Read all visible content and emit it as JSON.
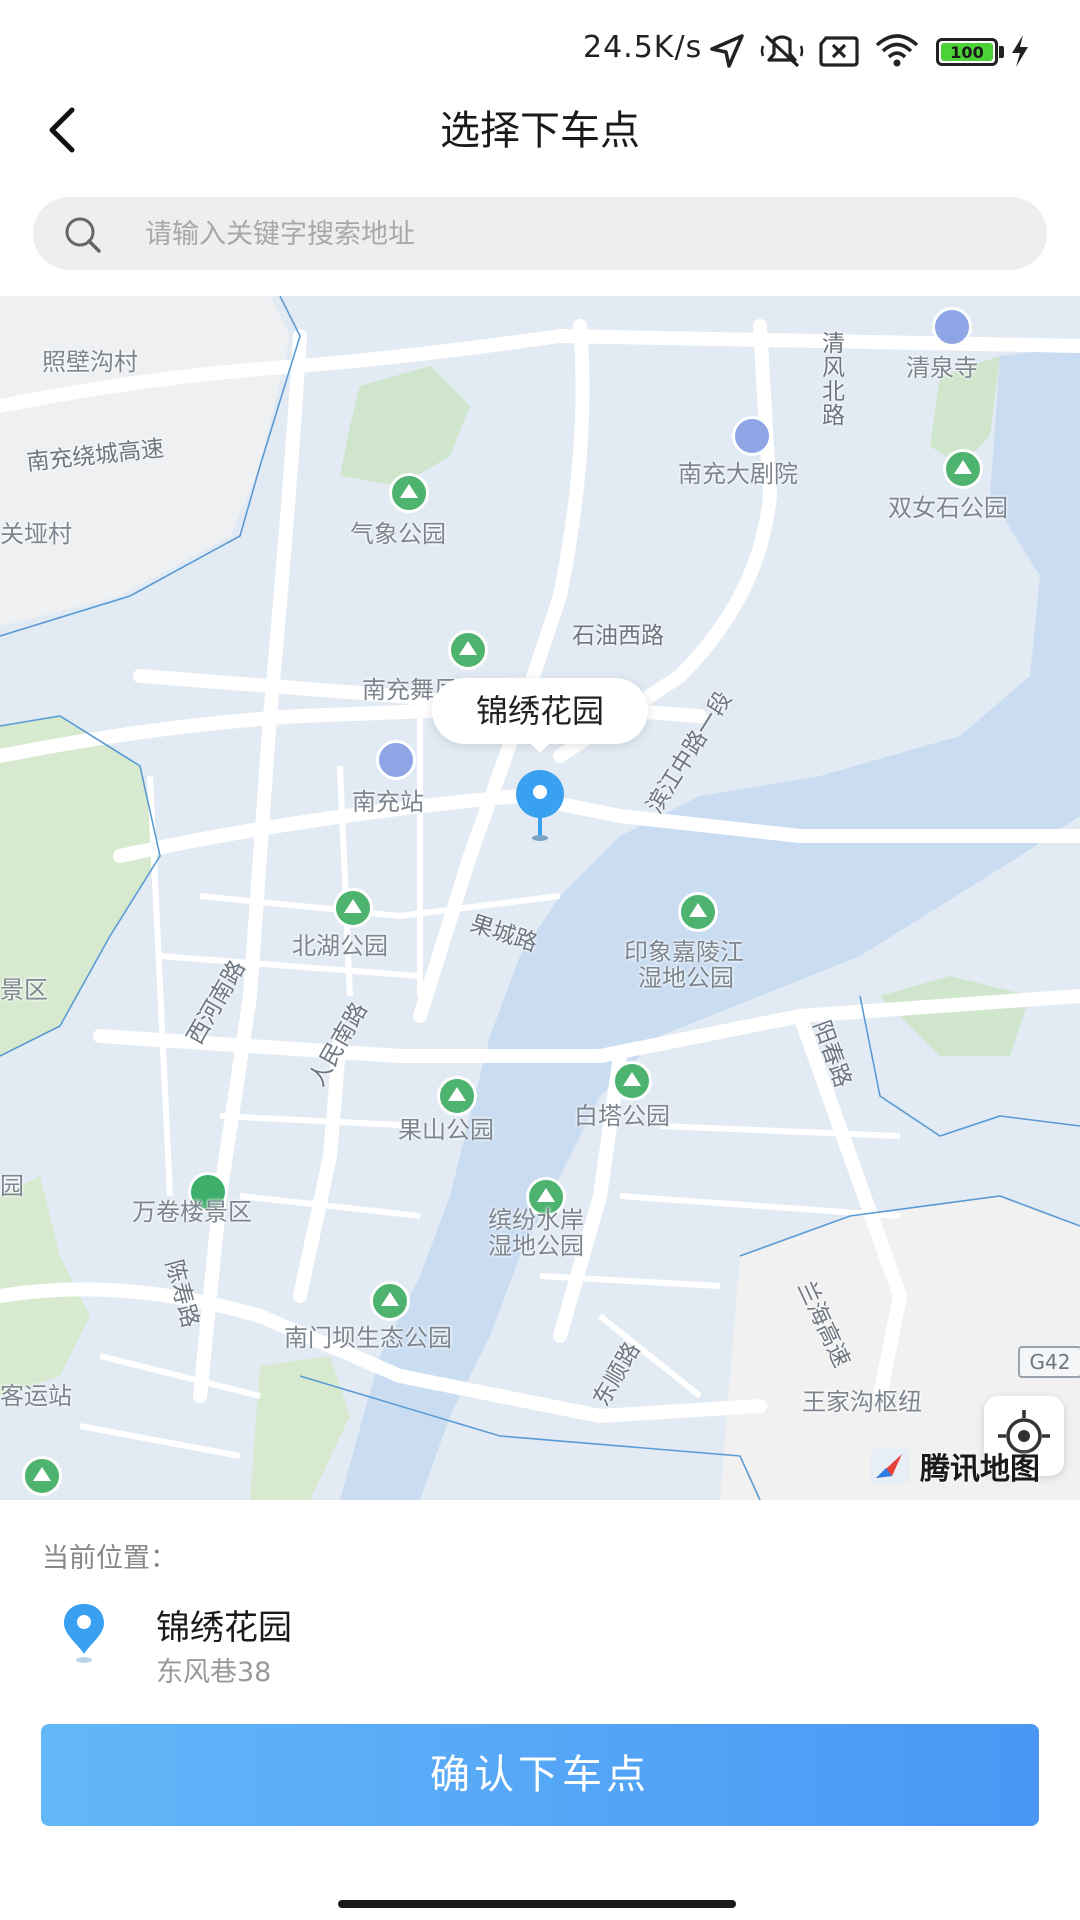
{
  "status_bar": {
    "network_speed": "24.5K/s",
    "battery": "100",
    "icons": [
      "location-arrow-icon",
      "mute-vibrate-icon",
      "sim-x-icon",
      "wifi-icon",
      "battery-icon",
      "charging-icon"
    ]
  },
  "header": {
    "title": "选择下车点",
    "back_icon": "chevron-left-icon"
  },
  "search": {
    "placeholder": "请输入关键字搜索地址",
    "value": ""
  },
  "map": {
    "selected_marker_label": "锦绣花园",
    "provider_logo": "腾讯地图",
    "highway_shield": "G42",
    "place_labels": {
      "zhaobigoucun": "照壁沟村",
      "qingfengbeilu": "清风北路",
      "qingquansi": "清泉寺",
      "nanchong_ring_expressway": "南充绕城高速",
      "nanchong_grand_theater": "南充大剧院",
      "shuangnvshi_park": "双女石公园",
      "guanyacun": "关垭村",
      "qixiang_park": "气象公园",
      "shiyou_west_road": "石油西路",
      "nanchong_wufengshan_park": "南充舞凤山公园",
      "binjiang_middle_road": "滨江中路一段",
      "nanchong_station": "南充站",
      "guocheng_road": "果城路",
      "beihu_park": "北湖公园",
      "yinxiang_jialingjiang": "印象嘉陵江",
      "wetland_park": "湿地公园",
      "jingqu": "景区",
      "xihe_road": "西河南路",
      "renmin_south_road": "人民南路",
      "yangchun_road": "阳春路",
      "guoshan_park": "果山公园",
      "baita_park": "白塔公园",
      "yuan": "园",
      "wanjuanlou": "万卷楼景区",
      "binfen_shuian": "缤纷水岸",
      "binfen_wetland": "湿地公园",
      "chenshou_road": "陈寿路",
      "nanmenba_park": "南门坝生态公园",
      "lanhai_expressway": "兰海高速",
      "dongshun_road": "东顺路",
      "keyunzhan": "客运站",
      "wangjiagou_hub": "王家沟枢纽"
    }
  },
  "panel": {
    "current_location_label": "当前位置：",
    "location_name": "锦绣花园",
    "location_address": "东风巷38",
    "confirm_button": "确认下车点"
  }
}
